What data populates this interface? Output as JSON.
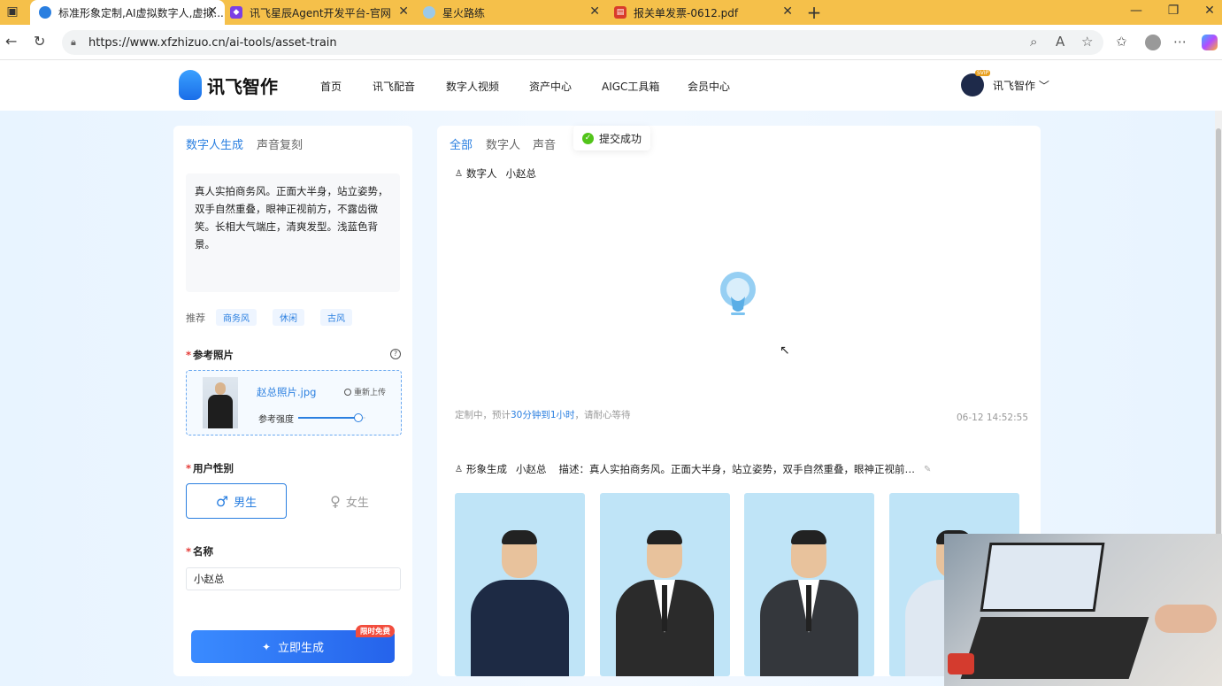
{
  "browser": {
    "tabs": [
      {
        "title": "标准形象定制,AI虚拟数字人,虚拟...",
        "active": true,
        "icon": "xunfei-tab-icon"
      },
      {
        "title": "讯飞星辰Agent开发平台-官网",
        "active": false,
        "icon": "xingchen-tab-icon"
      },
      {
        "title": "星火路练",
        "active": false,
        "icon": "xinghuo-tab-icon"
      },
      {
        "title": "报关单发票-0612.pdf",
        "active": false,
        "icon": "pdf-tab-icon"
      }
    ],
    "new_tab": "+",
    "url": "https://www.xfzhizuo.cn/ai-tools/asset-train"
  },
  "site": {
    "logo_text": "讯飞智作",
    "nav": [
      "首页",
      "讯飞配音",
      "数字人视频",
      "资产中心",
      "AIGC工具箱",
      "会员中心"
    ],
    "user_badge": "SVIP",
    "user_name": "讯飞智作 ﹀"
  },
  "left_panel": {
    "tabs": [
      "数字人生成",
      "声音复刻"
    ],
    "active_tab": 0,
    "prompt": "真人实拍商务风。正面大半身，站立姿势，双手自然重叠，眼神正视前方，不露齿微笑。长相大气端庄，清爽发型。浅蓝色背景。",
    "recommend_label": "推荐",
    "recommend_tags": [
      "商务风",
      "休闲",
      "古风"
    ],
    "photo_label": "参考照片",
    "photo_name": "赵总照片.jpg",
    "reupload_label": "重新上传",
    "strength_label": "参考强度",
    "strength_value": 0.9,
    "gender_label": "用户性别",
    "gender_male": "男生",
    "gender_female": "女生",
    "gender_selected": "male",
    "name_label": "名称",
    "name_value": "小赵总",
    "generate_label": "立即生成",
    "free_badge": "限时免费"
  },
  "right_panel": {
    "filter_tabs": [
      "全部",
      "数字人",
      "声音"
    ],
    "active_filter": 0,
    "toast": "提交成功",
    "item1": {
      "type_label": "数字人",
      "name": "小赵总",
      "status_prefix": "定制中，预计",
      "status_eta": "30分钟到1小时",
      "status_suffix": "，请耐心等待",
      "timestamp": "06-12 14:52:55"
    },
    "item2": {
      "type_label": "形象生成",
      "name": "小赵总",
      "desc": "描述：真人实拍商务风。正面大半身，站立姿势，双手自然重叠，眼神正视前…"
    }
  },
  "colors": {
    "accent": "#2a7fe0",
    "tabbar": "#f5c04a",
    "required": "#e53935",
    "badge": "#f24d3d",
    "success": "#52c41a",
    "card_bg": "#bfe4f7"
  }
}
